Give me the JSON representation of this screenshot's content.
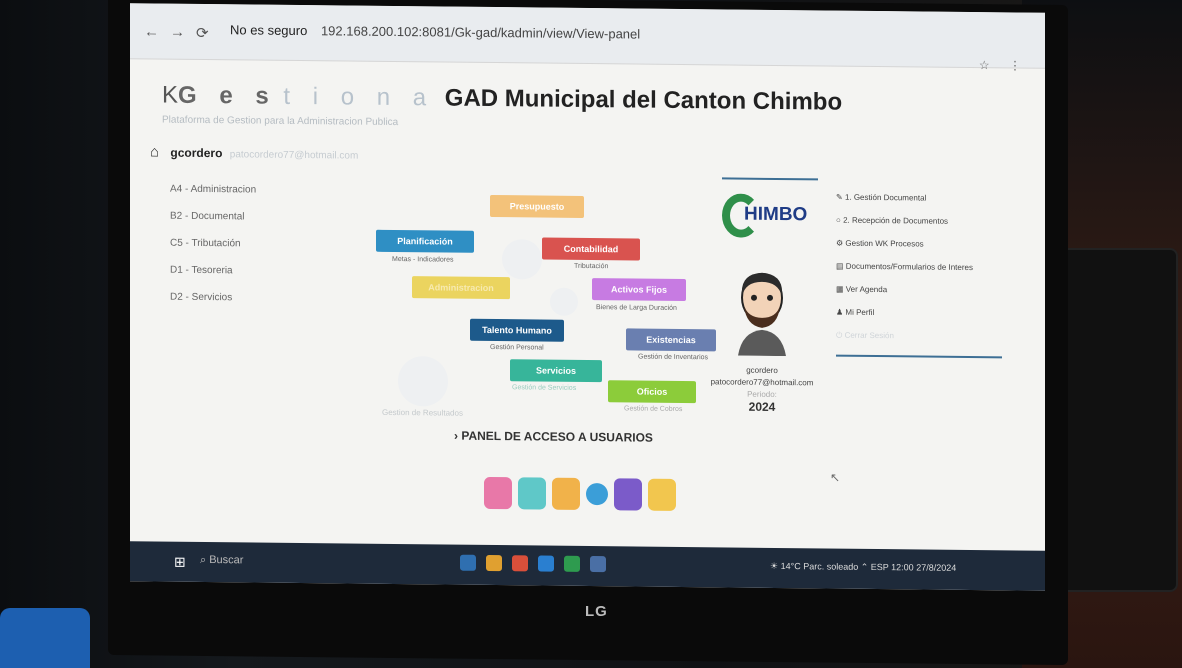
{
  "browser": {
    "security": "No es seguro",
    "url": "192.168.200.102:8081/Gk-gad/kadmin/view/View-panel"
  },
  "brand": {
    "k": "K",
    "ges": "G e s",
    "tiona": "t i o n a",
    "name": "GAD Municipal del Canton Chimbo",
    "subtitle": "Plataforma de Gestion para la Administracion Publica"
  },
  "user": {
    "username": "gcordero",
    "email": "patocordero77@hotmail.com",
    "period_label": "Periodo:",
    "period": "2024"
  },
  "sidebar": {
    "items": [
      {
        "label": "A4 - Administracion"
      },
      {
        "label": "B2 - Documental"
      },
      {
        "label": "C5 - Tributación"
      },
      {
        "label": "D1 - Tesoreria"
      },
      {
        "label": "D2 - Servicios"
      }
    ]
  },
  "modules": [
    {
      "label": "Presupuesto",
      "color": "#f3c27a"
    },
    {
      "label": "Planificación",
      "caption": "Metas - Indicadores",
      "color": "#2f8fc4"
    },
    {
      "label": "Contabilidad",
      "caption": "Tributación",
      "color": "#d9534f"
    },
    {
      "label": "Administracion",
      "color": "#ebd45f"
    },
    {
      "label": "Activos Fijos",
      "caption": "Bienes de Larga Duración",
      "color": "#c77be2"
    },
    {
      "label": "Talento Humano",
      "caption": "Gestión Personal",
      "color": "#1d5a8b"
    },
    {
      "label": "Existencias",
      "caption": "Gestión de Inventarios",
      "color": "#6a7fb0"
    },
    {
      "label": "Servicios",
      "caption": "Gestión de Servicios",
      "color": "#37b59a"
    },
    {
      "label": "Oficios",
      "caption": "Gestión de Cobros",
      "color": "#8ccc3a"
    },
    {
      "label": "Gestion de Resultados"
    }
  ],
  "panel_title": "PANEL DE ACCESO A USUARIOS",
  "logo": {
    "text": "HIMBO"
  },
  "right_menu": {
    "items": [
      {
        "icon": "pencil-icon",
        "label": "1. Gestión Documental"
      },
      {
        "icon": "circle-icon",
        "label": "2. Recepción de Documentos"
      },
      {
        "icon": "gear-icon",
        "label": "Gestion WK Procesos"
      },
      {
        "icon": "doc-icon",
        "label": "Documentos/Formularios de Interes"
      },
      {
        "icon": "calendar-icon",
        "label": "Ver Agenda"
      },
      {
        "icon": "user-icon",
        "label": "Mi Perfil"
      },
      {
        "icon": "power-icon",
        "label": "Cerrar Sesión"
      }
    ]
  },
  "taskbar": {
    "search": "Buscar",
    "weather": "14°C Parc. soleado",
    "lang": "ESP",
    "time": "12:00",
    "date": "27/8/2024"
  },
  "monitor_brand": "LG"
}
